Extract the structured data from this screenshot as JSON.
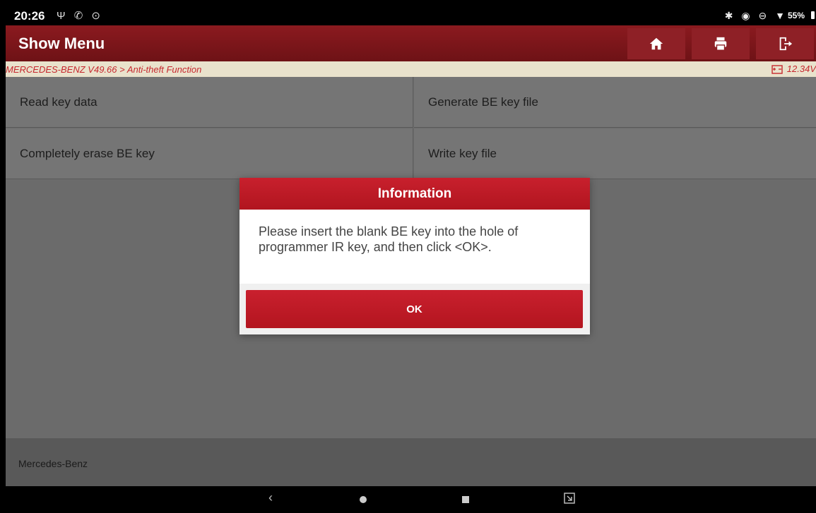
{
  "status_bar": {
    "time": "20:26",
    "left_icons": "Ψ ✆ ⊙",
    "right_icons": "✱ ◉ ⊖ ▼",
    "battery": "55%"
  },
  "header": {
    "title": "Show Menu",
    "buttons": [
      "home-icon",
      "print-icon",
      "exit-icon"
    ]
  },
  "breadcrumb": {
    "path": "MERCEDES-BENZ V49.66 > Anti-theft Function",
    "voltage": "12.34V"
  },
  "menu": {
    "items": [
      {
        "label": "Read key data"
      },
      {
        "label": "Generate BE key file"
      },
      {
        "label": "Completely erase BE key"
      },
      {
        "label": "Write key file"
      }
    ]
  },
  "footer": {
    "brand": "Mercedes-Benz"
  },
  "dialog": {
    "title": "Information",
    "message": "Please insert the blank BE key into the hole of programmer IR key, and then click <OK>.",
    "ok_label": "OK"
  },
  "colors": {
    "accent_red": "#c0202b",
    "header_red": "#7d161b",
    "breadcrumb_bg": "#e9e2cc"
  }
}
